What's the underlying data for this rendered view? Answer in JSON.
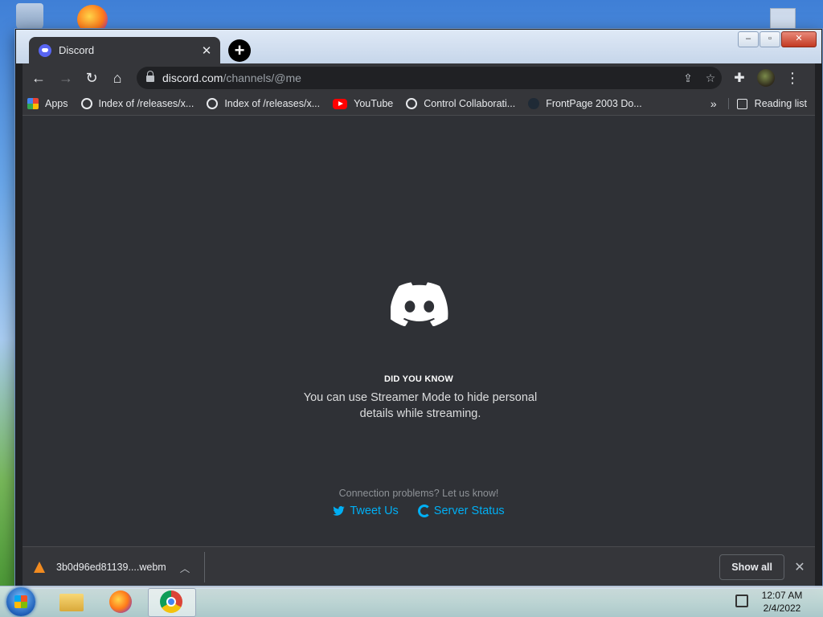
{
  "browser": {
    "tab_title": "Discord",
    "new_tab_symbol": "+",
    "url_host": "discord.com",
    "url_path": "/channels/@me",
    "bookmarks": [
      {
        "label": "Apps",
        "icon": "apps-grid-icon"
      },
      {
        "label": "Index of /releases/x...",
        "icon": "globe-icon"
      },
      {
        "label": "Index of /releases/x...",
        "icon": "globe-icon"
      },
      {
        "label": "YouTube",
        "icon": "youtube-icon"
      },
      {
        "label": "Control Collaborati...",
        "icon": "globe-icon"
      },
      {
        "label": "FrontPage 2003 Do...",
        "icon": "frontpage-icon"
      }
    ],
    "bookmarks_more": "»",
    "reading_list": "Reading list"
  },
  "discord": {
    "brand_color": "#5865f2",
    "tip_heading": "DID YOU KNOW",
    "tip_text": "You can use Streamer Mode to hide personal details while streaming.",
    "connection_text": "Connection problems? Let us know!",
    "tweet_us": "Tweet Us",
    "server_status": "Server Status"
  },
  "downloads": {
    "file_name": "3b0d96ed81139....webm",
    "show_all": "Show all"
  },
  "taskbar": {
    "time": "12:07 AM",
    "date": "2/4/2022",
    "apps": [
      "start-orb",
      "file-explorer",
      "firefox",
      "chrome"
    ]
  }
}
